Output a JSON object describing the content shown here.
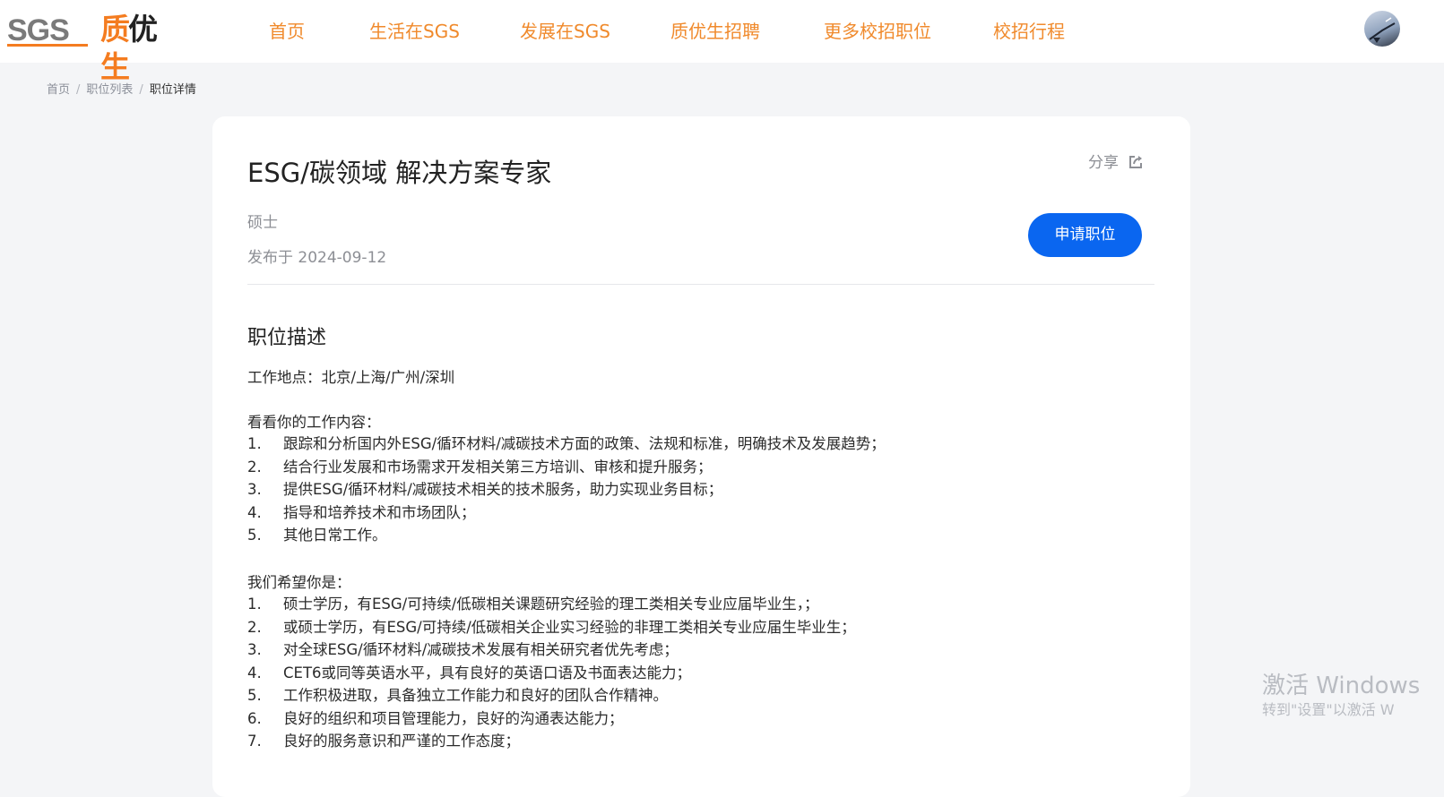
{
  "header": {
    "logo_sgs": "SGS",
    "logo_brand": [
      "质",
      "优",
      "生"
    ],
    "nav": [
      {
        "label": "首页"
      },
      {
        "label": "生活在SGS"
      },
      {
        "label": "发展在SGS"
      },
      {
        "label": "质优生招聘"
      },
      {
        "label": "更多校招职位"
      },
      {
        "label": "校招行程"
      }
    ],
    "nav_color": "#f08a2c"
  },
  "breadcrumb": {
    "items": [
      "首页",
      "职位列表"
    ],
    "current": "职位详情",
    "separator": "/"
  },
  "job": {
    "title": "ESG/碳领域 解决方案专家",
    "share_label": "分享",
    "degree": "硕士",
    "posted": "发布于 2024-09-12",
    "apply_label": "申请职位",
    "apply_color": "#0a66f0"
  },
  "description": {
    "section_title": "职位描述",
    "location": "工作地点：北京/上海/广州/深圳",
    "duties_heading": "看看你的工作内容：",
    "duties": [
      {
        "num": "1.",
        "text": "跟踪和分析国内外ESG/循环材料/减碳技术方面的政策、法规和标准，明确技术及发展趋势；"
      },
      {
        "num": "2.",
        "text": "结合行业发展和市场需求开发相关第三方培训、审核和提升服务；"
      },
      {
        "num": "3.",
        "text": "提供ESG/循环材料/减碳技术相关的技术服务，助力实现业务目标；"
      },
      {
        "num": "4.",
        "text": "指导和培养技术和市场团队；"
      },
      {
        "num": "5.",
        "text": "其他日常工作。"
      }
    ],
    "requirements_heading": "我们希望你是：",
    "requirements": [
      {
        "num": "1.",
        "text": "硕士学历，有ESG/可持续/低碳相关课题研究经验的理工类相关专业应届毕业生，；"
      },
      {
        "num": "2.",
        "text": "或硕士学历，有ESG/可持续/低碳相关企业实习经验的非理工类相关专业应届生毕业生；"
      },
      {
        "num": "3.",
        "text": "对全球ESG/循环材料/减碳技术发展有相关研究者优先考虑；"
      },
      {
        "num": "4.",
        "text": "CET6或同等英语水平，具有良好的英语口语及书面表达能力；"
      },
      {
        "num": "5.",
        "text": "工作积极进取，具备独立工作能力和良好的团队合作精神。"
      },
      {
        "num": "6.",
        "text": "良好的组织和项目管理能力，良好的沟通表达能力；"
      },
      {
        "num": "7.",
        "text": "良好的服务意识和严谨的工作态度；"
      }
    ]
  },
  "watermark": {
    "line1": "激活 Windows",
    "line2": "转到\"设置\"以激活 W"
  }
}
